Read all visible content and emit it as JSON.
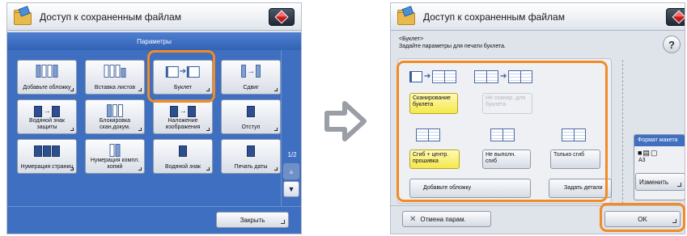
{
  "left_screen": {
    "title": "Доступ к сохраненным файлам",
    "section_header": "Параметры",
    "tiles": [
      {
        "label": "Добавьте обложку"
      },
      {
        "label": "Вставка листов"
      },
      {
        "label": "Буклет"
      },
      {
        "label": "Сдвиг"
      },
      {
        "label": "Водяной знак защиты"
      },
      {
        "label": "Блокировка скан.докум."
      },
      {
        "label": "Наложение изображения"
      },
      {
        "label": "Отступ"
      },
      {
        "label": "Нумерация страниц"
      },
      {
        "label": "Нумерация компл. копий"
      },
      {
        "label": "Водяной знак"
      },
      {
        "label": "Печать даты"
      }
    ],
    "page_indicator": "1/2",
    "scroll_up": "▲",
    "scroll_down": "▼",
    "close_label": "Закрыть",
    "highlight_color": "#f28a25"
  },
  "right_screen": {
    "title": "Доступ к сохраненным файлам",
    "subtitle": "<Буклет>",
    "instruction": "Задайте параметры для печати буклета.",
    "help": "?",
    "scan_booklet": "Сканирование буклета",
    "no_scan_booklet": "Не сканир. для буклета",
    "fold_saddle": "Сгиб + центр. прошивка",
    "do_not_perform": "Не выполн. сгиб",
    "fold_only": "Только сгиб",
    "add_cover": "Добавьте обложку",
    "set_details": "Задать детали",
    "format_title": "Формат макета",
    "format_icons": "■▤▢",
    "format_size": "A3",
    "change_label": "Изменить",
    "cancel_label": "Отмена парам.",
    "ok_label": "OK"
  },
  "colors": {
    "accent_orange": "#f28a25",
    "blue_bar": "#3f6fc0",
    "selected_yellow": "#f5e84a"
  }
}
